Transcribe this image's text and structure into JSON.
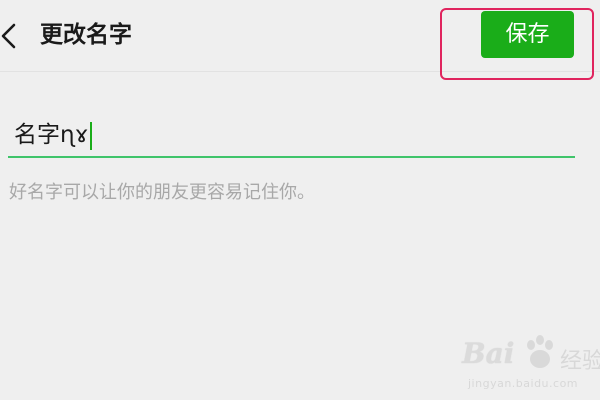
{
  "header": {
    "back_icon": "chevron-left-icon",
    "title": "更改名字",
    "save_label": "保存"
  },
  "name_field": {
    "value": "名字ɳɤ"
  },
  "hint": "好名字可以让你的朋友更容易记住你。",
  "watermark": {
    "brand": "Bai",
    "brand_suffix": "经验",
    "url": "jingyan.baidu.com"
  },
  "colors": {
    "accent": "#1aad19",
    "underline": "#3fc46a",
    "highlight": "#e0245e",
    "background": "#efefef"
  }
}
